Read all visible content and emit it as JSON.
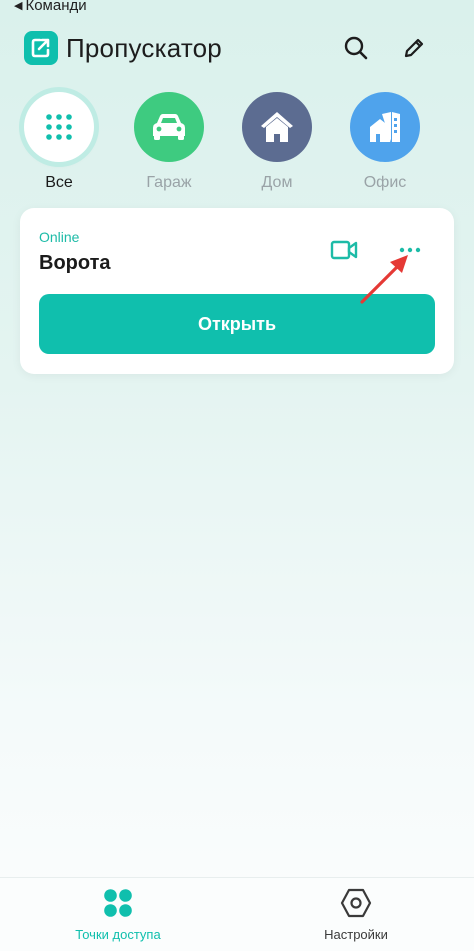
{
  "status_bar": {
    "back_label": "Команди"
  },
  "header": {
    "title": "Пропускатор",
    "icons": [
      "login-logo-icon",
      "search-icon",
      "edit-pencil-icon"
    ]
  },
  "categories": [
    {
      "label": "Все",
      "icon": "grid-dots-icon",
      "active": true,
      "color": "#ffffff"
    },
    {
      "label": "Гараж",
      "icon": "car-icon",
      "active": false,
      "color": "#3ecb80"
    },
    {
      "label": "Дом",
      "icon": "house-icon",
      "active": false,
      "color": "#5c6c91"
    },
    {
      "label": "Офис",
      "icon": "office-building-icon",
      "active": false,
      "color": "#4fa3ec"
    }
  ],
  "access_point": {
    "status": "Online",
    "name": "Ворота",
    "open_label": "Открыть",
    "icons": [
      "video-camera-icon",
      "more-dots-icon"
    ]
  },
  "tabbar": {
    "items": [
      {
        "label": "Точки доступа",
        "icon": "access-points-icon",
        "active": true
      },
      {
        "label": "Настройки",
        "icon": "settings-hexagon-icon",
        "active": false
      }
    ]
  },
  "colors": {
    "accent": "#10bfad",
    "annotation_arrow": "#e53935",
    "inactive_text": "#9aa3a7"
  }
}
